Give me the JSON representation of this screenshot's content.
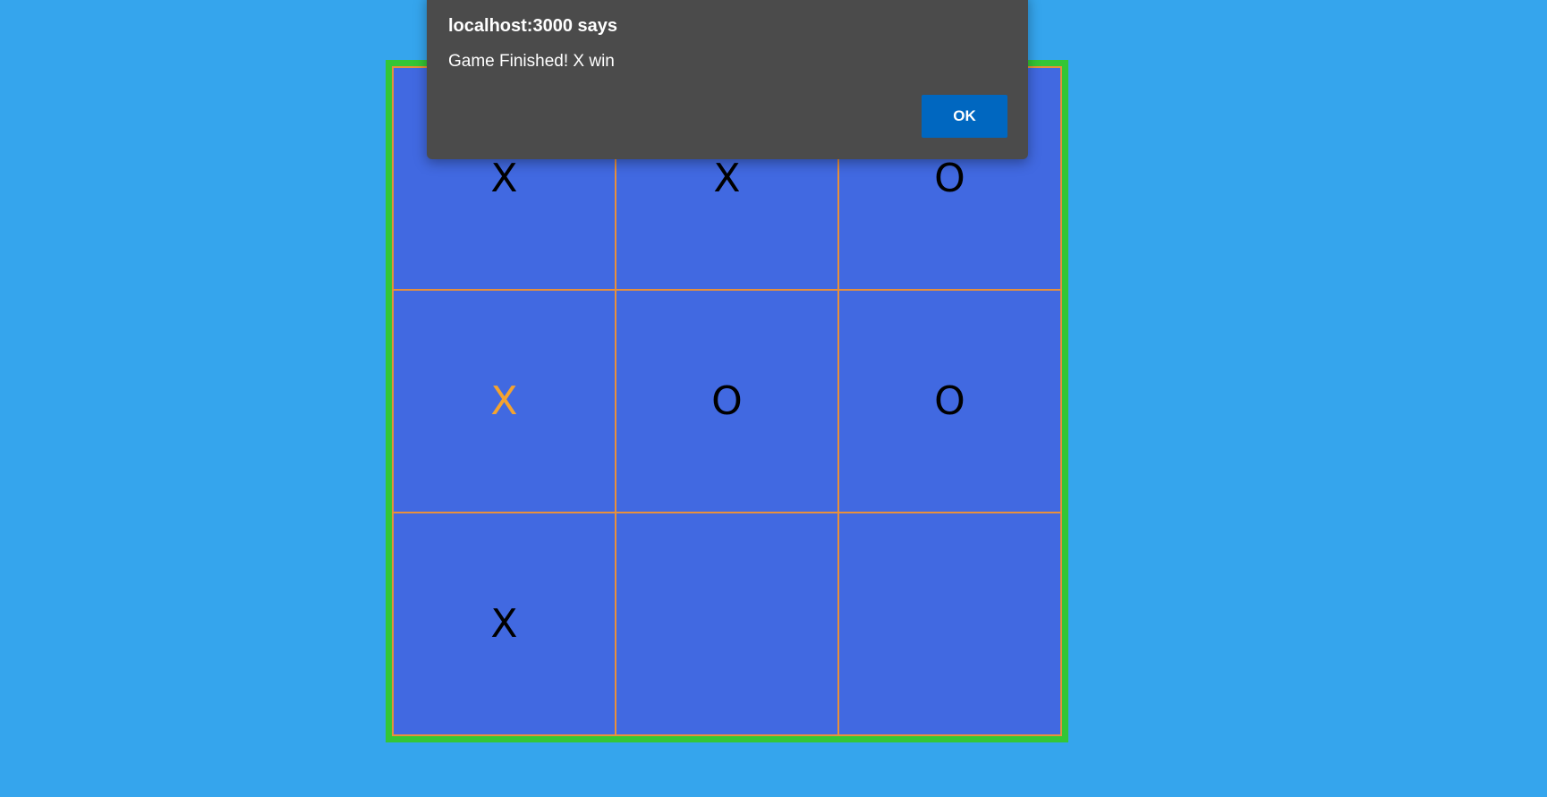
{
  "board": {
    "cells": [
      {
        "value": "X",
        "highlight": false
      },
      {
        "value": "X",
        "highlight": false
      },
      {
        "value": "O",
        "highlight": false
      },
      {
        "value": "X",
        "highlight": true
      },
      {
        "value": "O",
        "highlight": false
      },
      {
        "value": "O",
        "highlight": false
      },
      {
        "value": "X",
        "highlight": false
      },
      {
        "value": "",
        "highlight": false
      },
      {
        "value": "",
        "highlight": false
      }
    ]
  },
  "alert": {
    "title": "localhost:3000 says",
    "message": "Game Finished! X win",
    "ok_label": "OK"
  },
  "colors": {
    "page_background": "#35a5ed",
    "board_border": "#33c636",
    "board_background": "#4169e1",
    "grid_lines": "#e8903b",
    "highlight_mark": "#f4a32f",
    "dialog_background": "#4b4b4b",
    "ok_button": "#0067c0"
  }
}
